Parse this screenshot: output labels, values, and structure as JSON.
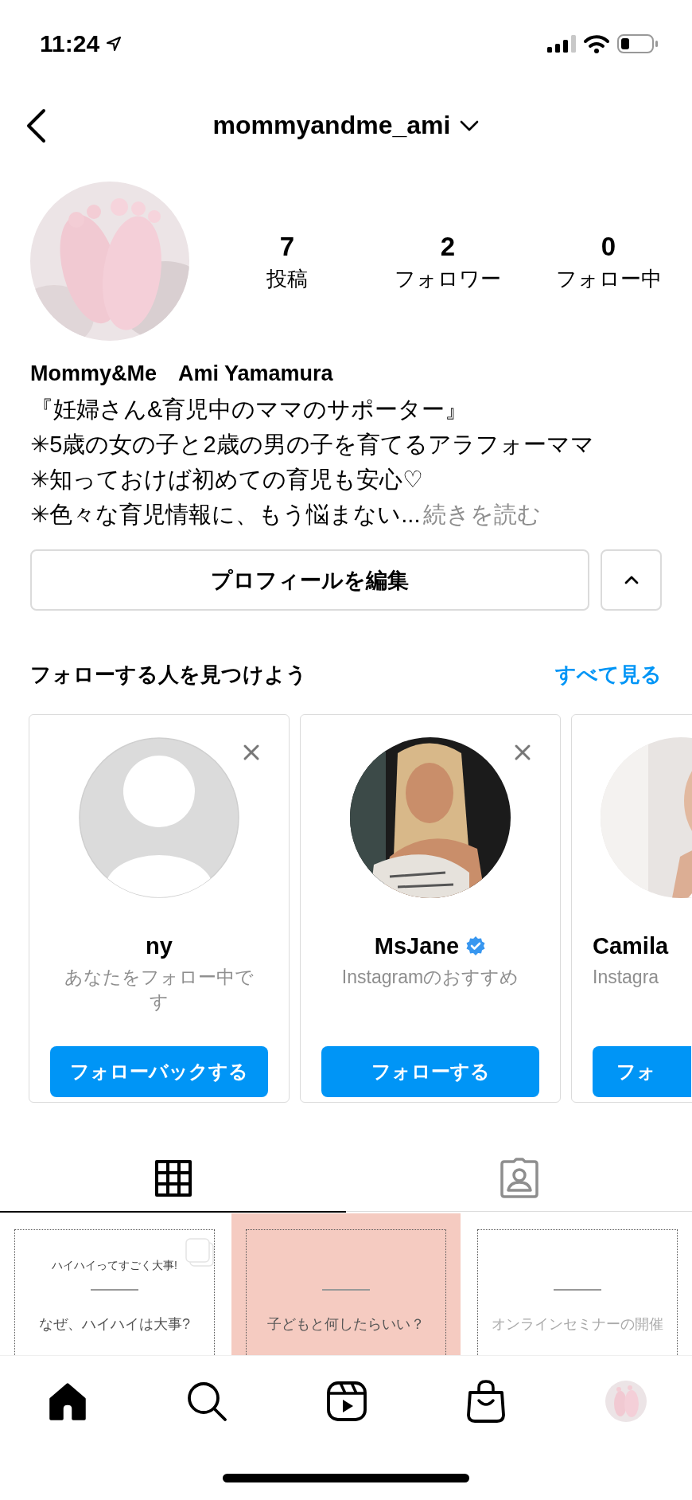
{
  "status_bar": {
    "time": "11:24"
  },
  "header": {
    "username": "mommyandme_ami"
  },
  "profile": {
    "stats": [
      {
        "value": "7",
        "label": "投稿"
      },
      {
        "value": "2",
        "label": "フォロワー"
      },
      {
        "value": "0",
        "label": "フォロー中"
      }
    ],
    "name": "Mommy&Me　Ami Yamamura",
    "bio_lines": [
      "『妊婦さん&育児中のママのサポーター』",
      "✳5歳の女の子と2歳の男の子を育てるアラフォーママ",
      "✳知っておけば初めての育児も安心♡"
    ],
    "bio_last": "✳色々な育児情報に、もう悩まない...",
    "bio_more": "続きを読む",
    "edit_button": "プロフィールを編集"
  },
  "discover": {
    "title": "フォローする人を見つけよう",
    "see_all": "すべて見る",
    "cards": [
      {
        "kind": "placeholder",
        "name": "ny",
        "verified": false,
        "subtitle": "あなたをフォロー中です",
        "button": "フォローバックする",
        "dismissable": true,
        "clipped": false
      },
      {
        "kind": "picture",
        "name": "MsJane",
        "verified": true,
        "subtitle": "Instagramのおすすめ",
        "button": "フォローする",
        "dismissable": true,
        "clipped": false
      },
      {
        "kind": "picture",
        "name": "Camila",
        "verified": false,
        "subtitle": "Instagra",
        "button": "フォ",
        "dismissable": false,
        "clipped": true
      }
    ]
  },
  "tabs": [
    {
      "kind": "grid",
      "selected": true
    },
    {
      "kind": "tagged",
      "selected": false
    }
  ],
  "posts": [
    {
      "color": "#ffffff",
      "title": "ハイハイってすごく大事!",
      "text": "なぜ、ハイハイは大事?",
      "multiple": true
    },
    {
      "color": "#f5cbc1",
      "text": "子どもと何したらいい？",
      "multiple": false
    },
    {
      "color": "#ffffff",
      "text": "オンラインセミナーの開催",
      "multiple": false
    }
  ],
  "nav": [
    {
      "kind": "home",
      "selected": true
    },
    {
      "kind": "search",
      "selected": false
    },
    {
      "kind": "reels",
      "selected": false
    },
    {
      "kind": "shop",
      "selected": false
    },
    {
      "kind": "profile",
      "selected": false
    }
  ]
}
